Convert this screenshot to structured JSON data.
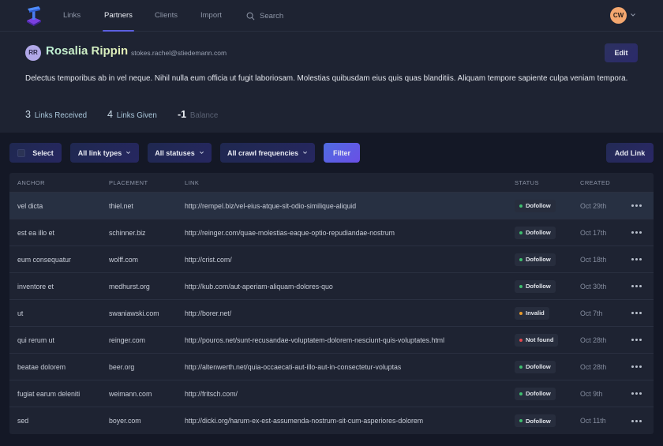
{
  "nav": {
    "items": [
      {
        "label": "Links",
        "active": false
      },
      {
        "label": "Partners",
        "active": true
      },
      {
        "label": "Clients",
        "active": false
      },
      {
        "label": "Import",
        "active": false
      }
    ],
    "search_label": "Search",
    "user_initials": "CW"
  },
  "profile": {
    "initials": "RR",
    "name": "Rosalia Rippin",
    "email": "stokes.rachel@stiedemann.com",
    "edit_label": "Edit",
    "description": "Delectus temporibus ab in vel neque. Nihil nulla eum officia ut fugit laboriosam. Molestias quibusdam eius quis quas blanditiis. Aliquam tempore sapiente culpa veniam tempora.",
    "stats": {
      "received": {
        "value": "3",
        "label": "Links Received"
      },
      "given": {
        "value": "4",
        "label": "Links Given"
      },
      "balance": {
        "value": "-1",
        "label": "Balance"
      }
    }
  },
  "toolbar": {
    "select_label": "Select",
    "link_types": "All link types",
    "statuses": "All statuses",
    "crawl": "All crawl frequencies",
    "filter_label": "Filter",
    "add_label": "Add Link"
  },
  "table": {
    "headers": {
      "anchor": "ANCHOR",
      "placement": "PLACEMENT",
      "link": "LINK",
      "status": "STATUS",
      "created": "CREATED"
    },
    "status_colors": {
      "Dofollow": "#3fbf6f",
      "Invalid": "#e89a2c",
      "Not found": "#e5484d"
    },
    "rows": [
      {
        "anchor": "vel dicta",
        "placement": "thiel.net",
        "link": "http://rempel.biz/vel-eius-atque-sit-odio-similique-aliquid",
        "status": "Dofollow",
        "created": "Oct 29th"
      },
      {
        "anchor": "est ea illo et",
        "placement": "schinner.biz",
        "link": "http://reinger.com/quae-molestias-eaque-optio-repudiandae-nostrum",
        "status": "Dofollow",
        "created": "Oct 17th"
      },
      {
        "anchor": "eum consequatur",
        "placement": "wolff.com",
        "link": "http://crist.com/",
        "status": "Dofollow",
        "created": "Oct 18th"
      },
      {
        "anchor": "inventore et",
        "placement": "medhurst.org",
        "link": "http://kub.com/aut-aperiam-aliquam-dolores-quo",
        "status": "Dofollow",
        "created": "Oct 30th"
      },
      {
        "anchor": "ut",
        "placement": "swaniawski.com",
        "link": "http://borer.net/",
        "status": "Invalid",
        "created": "Oct 7th"
      },
      {
        "anchor": "qui rerum ut",
        "placement": "reinger.com",
        "link": "http://pouros.net/sunt-recusandae-voluptatem-dolorem-nesciunt-quis-voluptates.html",
        "status": "Not found",
        "created": "Oct 28th"
      },
      {
        "anchor": "beatae dolorem",
        "placement": "beer.org",
        "link": "http://altenwerth.net/quia-occaecati-aut-illo-aut-in-consectetur-voluptas",
        "status": "Dofollow",
        "created": "Oct 28th"
      },
      {
        "anchor": "fugiat earum deleniti",
        "placement": "weimann.com",
        "link": "http://fritsch.com/",
        "status": "Dofollow",
        "created": "Oct 9th"
      },
      {
        "anchor": "sed",
        "placement": "boyer.com",
        "link": "http://dicki.org/harum-ex-est-assumenda-nostrum-sit-cum-asperiores-dolorem",
        "status": "Dofollow",
        "created": "Oct 11th"
      }
    ]
  }
}
